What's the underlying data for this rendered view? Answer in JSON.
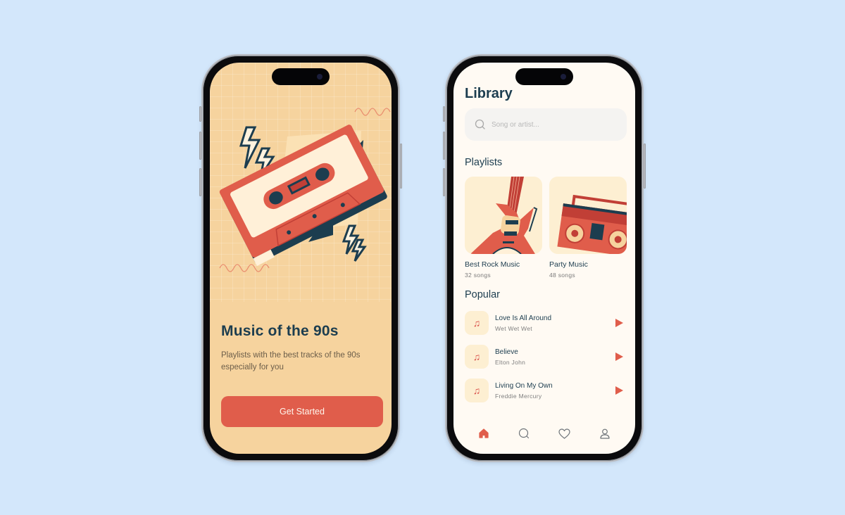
{
  "onboarding": {
    "title": "Music of the 90s",
    "subtitle": "Playlists with the best tracks of the 90s especially for you",
    "cta_label": "Get Started",
    "illustration": "cassette-tape-illustration"
  },
  "library": {
    "title": "Library",
    "search": {
      "placeholder": "Song or artist...",
      "value": "",
      "icon": "search-icon"
    },
    "playlists_heading": "Playlists",
    "playlists": [
      {
        "name": "Best Rock Music",
        "count": "32 songs",
        "art": "guitar-illustration"
      },
      {
        "name": "Party Music",
        "count": "48 songs",
        "art": "boombox-illustration"
      }
    ],
    "popular_heading": "Popular",
    "tracks": [
      {
        "title": "Love Is All Around",
        "artist": "Wet Wet Wet",
        "icon": "music-note-icon"
      },
      {
        "title": "Believe",
        "artist": "Elton John",
        "icon": "music-note-icon"
      },
      {
        "title": "Living On My Own",
        "artist": "Freddie Mercury",
        "icon": "music-note-icon"
      }
    ],
    "tabbar": [
      {
        "name": "home",
        "icon": "home-icon",
        "active": true
      },
      {
        "name": "search",
        "icon": "search-icon",
        "active": false
      },
      {
        "name": "favorites",
        "icon": "heart-icon",
        "active": false
      },
      {
        "name": "profile",
        "icon": "user-icon",
        "active": false
      }
    ]
  },
  "colors": {
    "background": "#d3e7fb",
    "accent": "#e05d4b",
    "navy": "#1c3d4f",
    "onboard_bg": "#f6d39e",
    "library_bg": "#fffaf3",
    "cream": "#fdefd2"
  }
}
